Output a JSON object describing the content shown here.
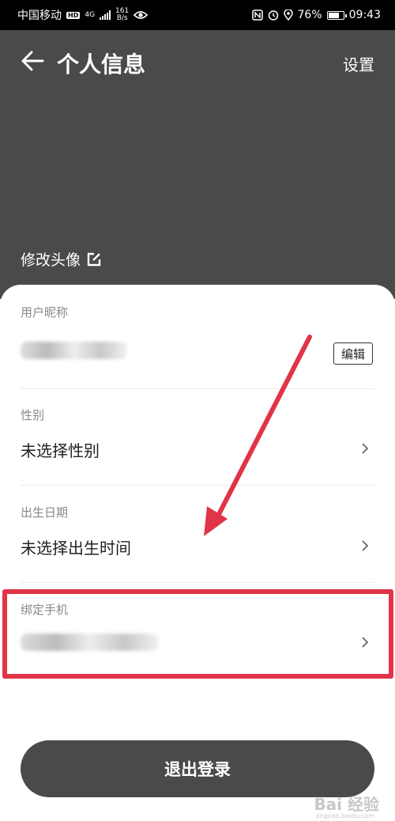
{
  "status_bar": {
    "carrier": "中国移动",
    "hd": "HD",
    "net_type": "4G",
    "net_speed_value": "161",
    "net_speed_unit": "B/s",
    "battery_percent": "76%",
    "battery_level": 0.76,
    "time": "09:43"
  },
  "header": {
    "title": "个人信息",
    "settings_label": "设置",
    "change_avatar_label": "修改头像"
  },
  "fields": {
    "nickname": {
      "label": "用户昵称",
      "edit_label": "编辑"
    },
    "gender": {
      "label": "性别",
      "value": "未选择性别"
    },
    "birthday": {
      "label": "出生日期",
      "value": "未选择出生时间"
    },
    "phone": {
      "label": "绑定手机"
    }
  },
  "logout_label": "退出登录",
  "watermark": {
    "brand": "Bai 经验",
    "url": "jingyan.baidu.com"
  },
  "colors": {
    "header_bg": "#4a4a4a",
    "highlight": "#e03448",
    "logout_bg": "#4a4a4a"
  },
  "icons": [
    "back-arrow-icon",
    "edit-square-icon",
    "chevron-right-icon",
    "eye-icon",
    "nfc-icon",
    "alarm-icon",
    "location-icon",
    "battery-icon",
    "signal-icon"
  ]
}
